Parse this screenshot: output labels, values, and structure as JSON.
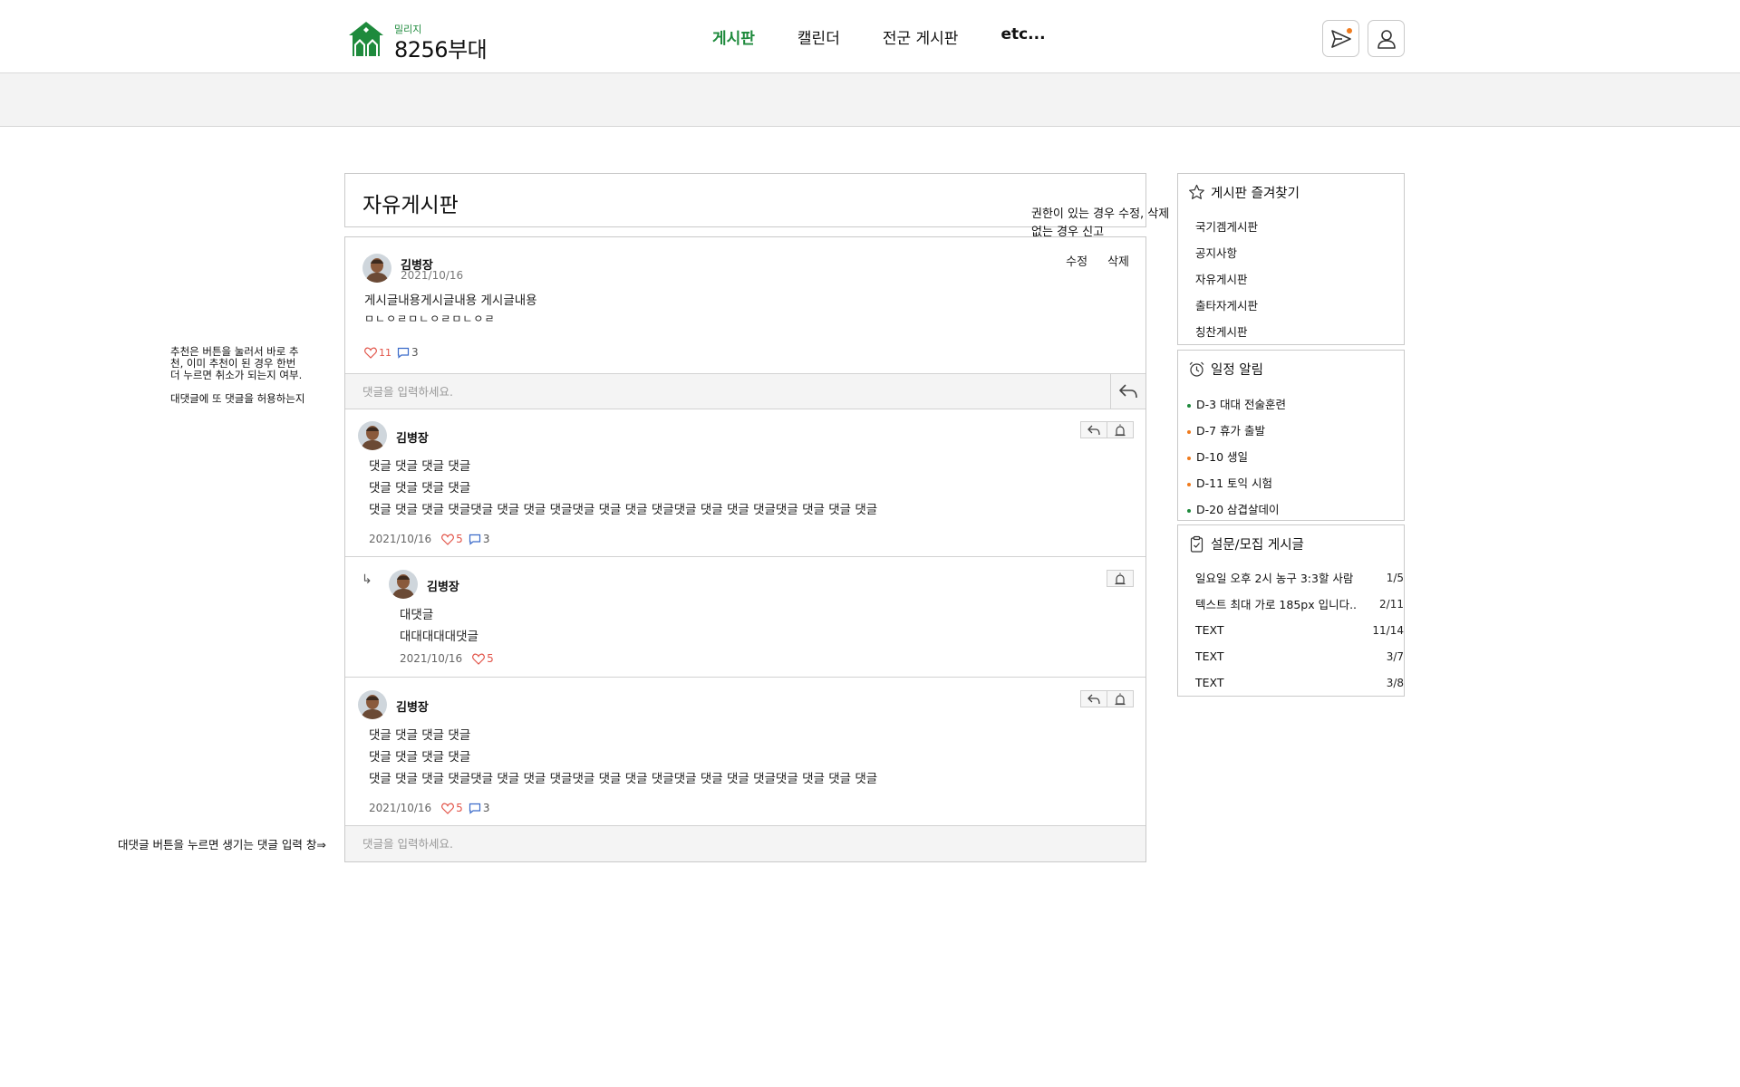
{
  "header": {
    "logo_sub": "밀리지",
    "logo_main": "8256부대",
    "nav": [
      {
        "label": "게시판",
        "active": true
      },
      {
        "label": "캘린더",
        "active": false
      },
      {
        "label": "전군 게시판",
        "active": false
      },
      {
        "label": "etc...",
        "active": false
      }
    ]
  },
  "board": {
    "title": "자유게시판",
    "permission_note_1": "권한이 있는 경우 수정, 삭제",
    "permission_note_2": "없는 경우 신고"
  },
  "post": {
    "author": "김병장",
    "date": "2021/10/16",
    "edit_label": "수정",
    "delete_label": "삭제",
    "body_line1": "게시글내용게시글내용 게시글내용",
    "body_line2": "ㅁㄴㅇㄹㅁㄴㅇㄹㅁㄴㅇㄹ",
    "likes": "11",
    "comments": "3",
    "comment_placeholder": "댓글을 입력하세요."
  },
  "comments": [
    {
      "author": "김병장",
      "lines": [
        "댓글 댓글 댓글 댓글",
        "댓글 댓글 댓글 댓글",
        "댓글 댓글 댓글 댓글댓글 댓글 댓글 댓글댓글 댓글 댓글 댓글댓글 댓글 댓글 댓글댓글 댓글 댓글 댓글"
      ],
      "date": "2021/10/16",
      "likes": "5",
      "replies": "3"
    },
    {
      "author": "김병장",
      "lines": [
        "대댓글",
        "대대대대대댓글"
      ],
      "date": "2021/10/16",
      "likes": "5"
    },
    {
      "author": "김병장",
      "lines": [
        "댓글 댓글 댓글 댓글",
        "댓글 댓글 댓글 댓글",
        "댓글 댓글 댓글 댓글댓글 댓글 댓글 댓글댓글 댓글 댓글 댓글댓글 댓글 댓글 댓글댓글 댓글 댓글 댓글"
      ],
      "date": "2021/10/16",
      "likes": "5",
      "replies": "3"
    }
  ],
  "reply_placeholder": "댓글을 입력하세요.",
  "sidebar": {
    "favorites": {
      "title": "게시판 즐겨찾기",
      "items": [
        "국기겜게시판",
        "공지사항",
        "자유게시판",
        "출타자게시판",
        "칭찬게시판"
      ]
    },
    "schedule": {
      "title": "일정 알림",
      "items": [
        {
          "label": "D-3 대대 전술훈련",
          "color": "#1e8a3c"
        },
        {
          "label": "D-7 휴가 출발",
          "color": "#f07b1d"
        },
        {
          "label": "D-10 생일",
          "color": "#f07b1d"
        },
        {
          "label": "D-11 토익 시험",
          "color": "#f07b1d"
        },
        {
          "label": "D-20 삼겹살데이",
          "color": "#1e8a3c"
        }
      ]
    },
    "survey": {
      "title": "설문/모집 게시글",
      "items": [
        {
          "label": "일요일 오후 2시 농구 3:3할 사람",
          "count": "1/5"
        },
        {
          "label": "텍스트 최대 가로 185px 입니다..",
          "count": "2/11"
        },
        {
          "label": "TEXT",
          "count": "11/14"
        },
        {
          "label": "TEXT",
          "count": "3/7"
        },
        {
          "label": "TEXT",
          "count": "3/8"
        }
      ]
    }
  },
  "annotations": {
    "like_note_1": "추천은 버튼을 눌러서 바로 추",
    "like_note_2": "천, 이미 추천이 된 경우 한번",
    "like_note_3": "더 누르면 취소가 되는지 여부.",
    "reply_note": "대댓글에 또 댓글을 허용하는지",
    "input_note": "대댓글 버튼을 누르면 생기는 댓글 입력 창⇒"
  },
  "colors": {
    "accent": "#1e8a3c",
    "orange": "#f07b1d",
    "like": "#e2554a",
    "comment": "#3a6ac9"
  }
}
